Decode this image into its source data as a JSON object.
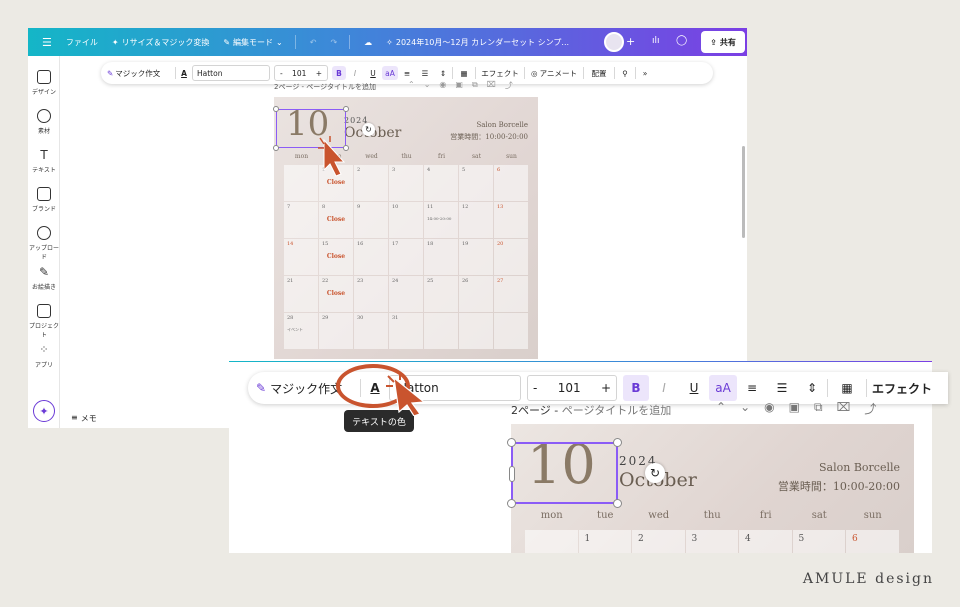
{
  "topbar": {
    "menu_icon": "hamburger-icon",
    "file": "ファイル",
    "resize": "リサイズ＆マジック変換",
    "edit_mode": "編集モード",
    "title": "2024年10月〜12月 カレンダーセット シンプ...",
    "share": "共有",
    "colors": {
      "start": "#14b6c7",
      "end": "#7b3fe4"
    }
  },
  "sidebar": {
    "items": [
      {
        "label": "デザイン",
        "icon": "design-icon"
      },
      {
        "label": "素材",
        "icon": "elements-icon"
      },
      {
        "label": "テキスト",
        "icon": "text-icon"
      },
      {
        "label": "ブランド",
        "icon": "brand-icon"
      },
      {
        "label": "アップロード",
        "icon": "upload-icon"
      },
      {
        "label": "お絵描き",
        "icon": "draw-icon"
      },
      {
        "label": "プロジェクト",
        "icon": "folder-icon"
      },
      {
        "label": "アプリ",
        "icon": "apps-icon"
      }
    ],
    "memo": "メモ"
  },
  "toolbar": {
    "magic_write": "マジック作文",
    "font": "Hatton",
    "font_size": "101",
    "minus": "-",
    "plus": "+",
    "bold": "B",
    "italic": "I",
    "underline": "U",
    "case": "aA",
    "effects": "エフェクト",
    "animate": "アニメート",
    "position": "配置",
    "text_color_tooltip": "テキストの色"
  },
  "page": {
    "title_prefix": "2ページ - ",
    "title_placeholder": "ページタイトルを追加"
  },
  "calendar": {
    "month_number": "10",
    "year": "2024",
    "month_name": "October",
    "shop": "Salon Borcelle",
    "hours": "営業時間：10:00-20:00",
    "weekdays": [
      "mon",
      "tue",
      "wed",
      "thu",
      "fri",
      "sat",
      "sun"
    ],
    "weeks": [
      [
        {
          "d": ""
        },
        {
          "d": "1",
          "note": "Close"
        },
        {
          "d": "2"
        },
        {
          "d": "3"
        },
        {
          "d": "4"
        },
        {
          "d": "5"
        },
        {
          "d": "6",
          "red": true
        }
      ],
      [
        {
          "d": "7"
        },
        {
          "d": "8",
          "note": "Close"
        },
        {
          "d": "9"
        },
        {
          "d": "10"
        },
        {
          "d": "11",
          "sub": "14:00-20:00"
        },
        {
          "d": "12"
        },
        {
          "d": "13",
          "red": true
        }
      ],
      [
        {
          "d": "14",
          "red": true
        },
        {
          "d": "15",
          "note": "Close"
        },
        {
          "d": "16"
        },
        {
          "d": "17"
        },
        {
          "d": "18"
        },
        {
          "d": "19"
        },
        {
          "d": "20",
          "red": true
        }
      ],
      [
        {
          "d": "21"
        },
        {
          "d": "22",
          "note": "Close"
        },
        {
          "d": "23"
        },
        {
          "d": "24"
        },
        {
          "d": "25"
        },
        {
          "d": "26"
        },
        {
          "d": "27",
          "red": true
        }
      ],
      [
        {
          "d": "28",
          "sub": "イベント"
        },
        {
          "d": "29"
        },
        {
          "d": "30"
        },
        {
          "d": "31"
        },
        {
          "d": ""
        },
        {
          "d": ""
        },
        {
          "d": ""
        }
      ]
    ],
    "accent": "#c9542e"
  },
  "footer": "AMULE design"
}
